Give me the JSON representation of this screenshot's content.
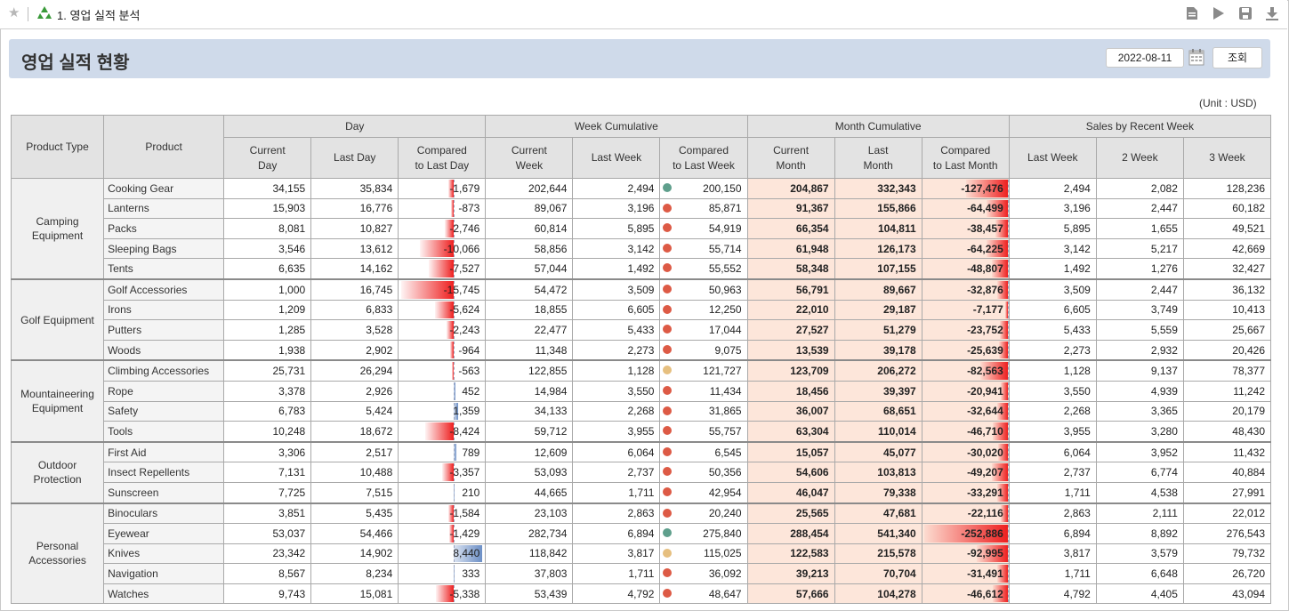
{
  "app": {
    "title": "1. 영업 실적 분석"
  },
  "toolbar": {
    "icons": [
      "document-icon",
      "play-icon",
      "save-icon",
      "download-icon"
    ]
  },
  "header": {
    "title": "영업 실적 현황",
    "date": "2022-08-11",
    "query_label": "조회"
  },
  "unit": "(Unit : USD)",
  "columns": {
    "product_type": "Product Type",
    "product": "Product",
    "groups": [
      "Day",
      "Week Cumulative",
      "Month Cumulative",
      "Sales by Recent Week"
    ],
    "sub": [
      "Current\nDay",
      "Last Day",
      "Compared\nto Last Day",
      "Current\nWeek",
      "Last Week",
      "Compared\nto Last Week",
      "Current\nMonth",
      "Last\nMonth",
      "Compared\nto Last Month",
      "Last Week",
      "2 Week",
      "3 Week"
    ]
  },
  "colors": {
    "neg": "#ee1f1f",
    "pos": "#6c8fc6",
    "dot_red": "#dd5a45",
    "dot_green": "#5f9f8c",
    "dot_yellow": "#e6bf7f",
    "month_bg": "#fde6da"
  },
  "groups": [
    {
      "type": "Camping\nEquipment",
      "rows": [
        {
          "product": "Cooking Gear",
          "cd": "34,155",
          "ld": "35,834",
          "cmp": "-1,679",
          "cmpv": -1679,
          "cw": "202,644",
          "lw": "2,494",
          "dot": "green",
          "cwk": "200,150",
          "cm": "204,867",
          "lm": "332,343",
          "cmm": "-127,476",
          "cmmv": -127476,
          "w1": "2,494",
          "w2": "2,082",
          "w3": "128,236"
        },
        {
          "product": "Lanterns",
          "cd": "15,903",
          "ld": "16,776",
          "cmp": "-873",
          "cmpv": -873,
          "cw": "89,067",
          "lw": "3,196",
          "dot": "red",
          "cwk": "85,871",
          "cm": "91,367",
          "lm": "155,866",
          "cmm": "-64,499",
          "cmmv": -64499,
          "w1": "3,196",
          "w2": "2,447",
          "w3": "60,182"
        },
        {
          "product": "Packs",
          "cd": "8,081",
          "ld": "10,827",
          "cmp": "-2,746",
          "cmpv": -2746,
          "cw": "60,814",
          "lw": "5,895",
          "dot": "red",
          "cwk": "54,919",
          "cm": "66,354",
          "lm": "104,811",
          "cmm": "-38,457",
          "cmmv": -38457,
          "w1": "5,895",
          "w2": "1,655",
          "w3": "49,521"
        },
        {
          "product": "Sleeping Bags",
          "cd": "3,546",
          "ld": "13,612",
          "cmp": "-10,066",
          "cmpv": -10066,
          "cw": "58,856",
          "lw": "3,142",
          "dot": "red",
          "cwk": "55,714",
          "cm": "61,948",
          "lm": "126,173",
          "cmm": "-64,225",
          "cmmv": -64225,
          "w1": "3,142",
          "w2": "5,217",
          "w3": "42,669"
        },
        {
          "product": "Tents",
          "cd": "6,635",
          "ld": "14,162",
          "cmp": "-7,527",
          "cmpv": -7527,
          "cw": "57,044",
          "lw": "1,492",
          "dot": "red",
          "cwk": "55,552",
          "cm": "58,348",
          "lm": "107,155",
          "cmm": "-48,807",
          "cmmv": -48807,
          "w1": "1,492",
          "w2": "1,276",
          "w3": "32,427"
        }
      ]
    },
    {
      "type": "Golf Equipment",
      "rows": [
        {
          "product": "Golf Accessories",
          "cd": "1,000",
          "ld": "16,745",
          "cmp": "-15,745",
          "cmpv": -15745,
          "cw": "54,472",
          "lw": "3,509",
          "dot": "red",
          "cwk": "50,963",
          "cm": "56,791",
          "lm": "89,667",
          "cmm": "-32,876",
          "cmmv": -32876,
          "w1": "3,509",
          "w2": "2,447",
          "w3": "36,132"
        },
        {
          "product": "Irons",
          "cd": "1,209",
          "ld": "6,833",
          "cmp": "-5,624",
          "cmpv": -5624,
          "cw": "18,855",
          "lw": "6,605",
          "dot": "red",
          "cwk": "12,250",
          "cm": "22,010",
          "lm": "29,187",
          "cmm": "-7,177",
          "cmmv": -7177,
          "w1": "6,605",
          "w2": "3,749",
          "w3": "10,413"
        },
        {
          "product": "Putters",
          "cd": "1,285",
          "ld": "3,528",
          "cmp": "-2,243",
          "cmpv": -2243,
          "cw": "22,477",
          "lw": "5,433",
          "dot": "red",
          "cwk": "17,044",
          "cm": "27,527",
          "lm": "51,279",
          "cmm": "-23,752",
          "cmmv": -23752,
          "w1": "5,433",
          "w2": "5,559",
          "w3": "25,667"
        },
        {
          "product": "Woods",
          "cd": "1,938",
          "ld": "2,902",
          "cmp": "-964",
          "cmpv": -964,
          "cw": "11,348",
          "lw": "2,273",
          "dot": "red",
          "cwk": "9,075",
          "cm": "13,539",
          "lm": "39,178",
          "cmm": "-25,639",
          "cmmv": -25639,
          "w1": "2,273",
          "w2": "2,932",
          "w3": "20,426"
        }
      ]
    },
    {
      "type": "Mountaineering\nEquipment",
      "rows": [
        {
          "product": "Climbing Accessories",
          "cd": "25,731",
          "ld": "26,294",
          "cmp": "-563",
          "cmpv": -563,
          "cw": "122,855",
          "lw": "1,128",
          "dot": "yellow",
          "cwk": "121,727",
          "cm": "123,709",
          "lm": "206,272",
          "cmm": "-82,563",
          "cmmv": -82563,
          "w1": "1,128",
          "w2": "9,137",
          "w3": "78,377"
        },
        {
          "product": "Rope",
          "cd": "3,378",
          "ld": "2,926",
          "cmp": "452",
          "cmpv": 452,
          "cw": "14,984",
          "lw": "3,550",
          "dot": "red",
          "cwk": "11,434",
          "cm": "18,456",
          "lm": "39,397",
          "cmm": "-20,941",
          "cmmv": -20941,
          "w1": "3,550",
          "w2": "4,939",
          "w3": "11,242"
        },
        {
          "product": "Safety",
          "cd": "6,783",
          "ld": "5,424",
          "cmp": "1,359",
          "cmpv": 1359,
          "cw": "34,133",
          "lw": "2,268",
          "dot": "red",
          "cwk": "31,865",
          "cm": "36,007",
          "lm": "68,651",
          "cmm": "-32,644",
          "cmmv": -32644,
          "w1": "2,268",
          "w2": "3,365",
          "w3": "20,179"
        },
        {
          "product": "Tools",
          "cd": "10,248",
          "ld": "18,672",
          "cmp": "-8,424",
          "cmpv": -8424,
          "cw": "59,712",
          "lw": "3,955",
          "dot": "red",
          "cwk": "55,757",
          "cm": "63,304",
          "lm": "110,014",
          "cmm": "-46,710",
          "cmmv": -46710,
          "w1": "3,955",
          "w2": "3,280",
          "w3": "48,430"
        }
      ]
    },
    {
      "type": "Outdoor\nProtection",
      "rows": [
        {
          "product": "First Aid",
          "cd": "3,306",
          "ld": "2,517",
          "cmp": "789",
          "cmpv": 789,
          "cw": "12,609",
          "lw": "6,064",
          "dot": "red",
          "cwk": "6,545",
          "cm": "15,057",
          "lm": "45,077",
          "cmm": "-30,020",
          "cmmv": -30020,
          "w1": "6,064",
          "w2": "3,952",
          "w3": "11,432"
        },
        {
          "product": "Insect Repellents",
          "cd": "7,131",
          "ld": "10,488",
          "cmp": "-3,357",
          "cmpv": -3357,
          "cw": "53,093",
          "lw": "2,737",
          "dot": "red",
          "cwk": "50,356",
          "cm": "54,606",
          "lm": "103,813",
          "cmm": "-49,207",
          "cmmv": -49207,
          "w1": "2,737",
          "w2": "6,774",
          "w3": "40,884"
        },
        {
          "product": "Sunscreen",
          "cd": "7,725",
          "ld": "7,515",
          "cmp": "210",
          "cmpv": 210,
          "cw": "44,665",
          "lw": "1,711",
          "dot": "red",
          "cwk": "42,954",
          "cm": "46,047",
          "lm": "79,338",
          "cmm": "-33,291",
          "cmmv": -33291,
          "w1": "1,711",
          "w2": "4,538",
          "w3": "27,991"
        }
      ]
    },
    {
      "type": "Personal\nAccessories",
      "rows": [
        {
          "product": "Binoculars",
          "cd": "3,851",
          "ld": "5,435",
          "cmp": "-1,584",
          "cmpv": -1584,
          "cw": "23,103",
          "lw": "2,863",
          "dot": "red",
          "cwk": "20,240",
          "cm": "25,565",
          "lm": "47,681",
          "cmm": "-22,116",
          "cmmv": -22116,
          "w1": "2,863",
          "w2": "2,111",
          "w3": "22,012"
        },
        {
          "product": "Eyewear",
          "cd": "53,037",
          "ld": "54,466",
          "cmp": "-1,429",
          "cmpv": -1429,
          "cw": "282,734",
          "lw": "6,894",
          "dot": "green",
          "cwk": "275,840",
          "cm": "288,454",
          "lm": "541,340",
          "cmm": "-252,886",
          "cmmv": -252886,
          "w1": "6,894",
          "w2": "8,892",
          "w3": "276,543"
        },
        {
          "product": "Knives",
          "cd": "23,342",
          "ld": "14,902",
          "cmp": "8,440",
          "cmpv": 8440,
          "cw": "118,842",
          "lw": "3,817",
          "dot": "yellow",
          "cwk": "115,025",
          "cm": "122,583",
          "lm": "215,578",
          "cmm": "-92,995",
          "cmmv": -92995,
          "w1": "3,817",
          "w2": "3,579",
          "w3": "79,732"
        },
        {
          "product": "Navigation",
          "cd": "8,567",
          "ld": "8,234",
          "cmp": "333",
          "cmpv": 333,
          "cw": "37,803",
          "lw": "1,711",
          "dot": "red",
          "cwk": "36,092",
          "cm": "39,213",
          "lm": "70,704",
          "cmm": "-31,491",
          "cmmv": -31491,
          "w1": "1,711",
          "w2": "6,648",
          "w3": "26,720"
        },
        {
          "product": "Watches",
          "cd": "9,743",
          "ld": "15,081",
          "cmp": "-5,338",
          "cmpv": -5338,
          "cw": "53,439",
          "lw": "4,792",
          "dot": "red",
          "cwk": "48,647",
          "cm": "57,666",
          "lm": "104,278",
          "cmm": "-46,612",
          "cmmv": -46612,
          "w1": "4,792",
          "w2": "4,405",
          "w3": "43,094"
        }
      ]
    }
  ]
}
